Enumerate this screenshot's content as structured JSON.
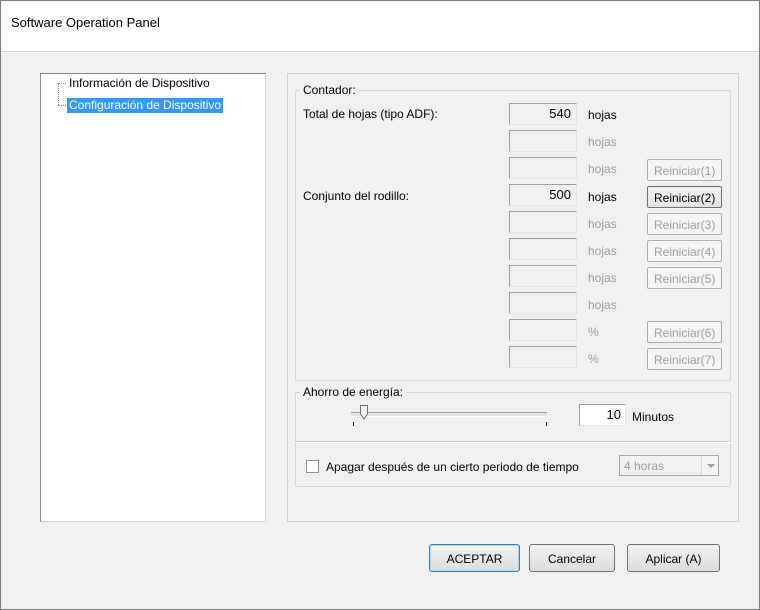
{
  "window": {
    "title": "Software Operation Panel"
  },
  "tree": {
    "items": [
      {
        "label": "Información de Dispositivo",
        "selected": false
      },
      {
        "label": "Configuración de Dispositivo",
        "selected": true
      }
    ]
  },
  "counter_group": {
    "legend": "Contador:",
    "total_label": "Total de hojas (tipo ADF):",
    "roller_label": "Conjunto del rodillo:",
    "rows": [
      {
        "value": "540",
        "unit": "hojas",
        "reset": ""
      },
      {
        "value": "",
        "unit": "hojas",
        "reset": ""
      },
      {
        "value": "",
        "unit": "hojas",
        "reset": "Reiniciar(1)"
      },
      {
        "value": "500",
        "unit": "hojas",
        "reset": "Reiniciar(2)"
      },
      {
        "value": "",
        "unit": "hojas",
        "reset": "Reiniciar(3)"
      },
      {
        "value": "",
        "unit": "hojas",
        "reset": "Reiniciar(4)"
      },
      {
        "value": "",
        "unit": "hojas",
        "reset": "Reiniciar(5)"
      },
      {
        "value": "",
        "unit": "hojas",
        "reset": ""
      },
      {
        "value": "",
        "unit": "%",
        "reset": "Reiniciar(6)"
      },
      {
        "value": "",
        "unit": "%",
        "reset": "Reiniciar(7)"
      }
    ]
  },
  "power_group": {
    "legend": "Ahorro de energía:",
    "minutes_value": "10",
    "minutes_unit": "Minutos",
    "slider_level_fraction": 0.05,
    "shutdown_label": "Apagar después de un cierto periodo de tiempo",
    "shutdown_checked": false,
    "shutdown_select": "4 horas"
  },
  "buttons": {
    "ok": "ACEPTAR",
    "cancel": "Cancelar",
    "apply": "Aplicar (A)"
  },
  "colors": {
    "selection": "#3399ff",
    "disabled_text": "#a0a0a0"
  }
}
